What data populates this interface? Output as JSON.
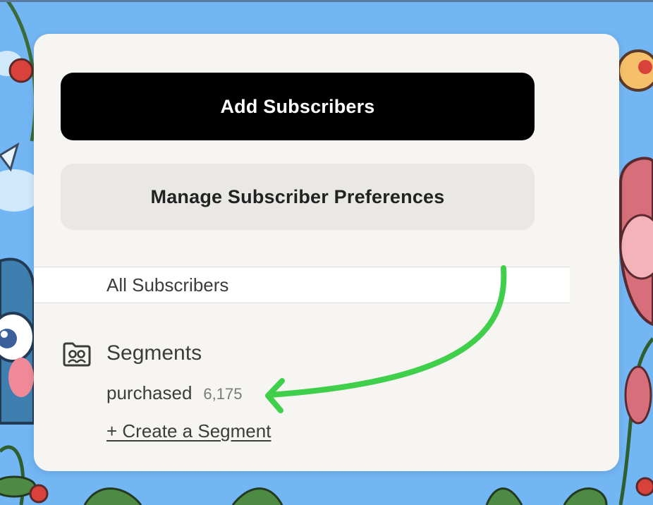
{
  "actions": {
    "add_subscribers_label": "Add Subscribers",
    "manage_preferences_label": "Manage Subscriber Preferences"
  },
  "nav": {
    "all_subscribers_label": "All Subscribers"
  },
  "segments": {
    "title": "Segments",
    "items": [
      {
        "name": "purchased",
        "count": "6,175"
      }
    ],
    "create_label": "+ Create a Segment"
  },
  "annotation": {
    "arrow_color": "#3fcf4b",
    "arrow_target": "purchased segment count"
  },
  "icons": {
    "segments_icon": "folder-people-icon"
  }
}
